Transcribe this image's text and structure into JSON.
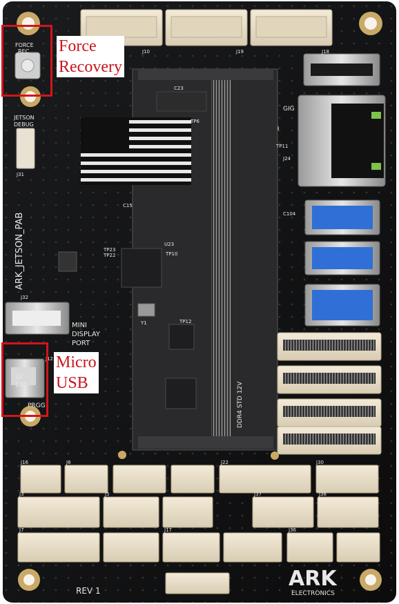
{
  "board": {
    "silkscreen": {
      "board_name": "ARK_JETSON_PAB",
      "force_rec": [
        "FORCE",
        "REC"
      ],
      "jetson_debug": [
        "JETSON",
        "DEBUG"
      ],
      "mini_dp": [
        "MINI",
        "DISPLAY",
        "PORT"
      ],
      "prog": "PRGG",
      "slot": "DDR4 STD 12V",
      "revision": "REV 1",
      "logo": "ARK",
      "brand": "ELECTRONICS",
      "gig": "GIG",
      "refdes": [
        "J10",
        "J19",
        "J18",
        "J22",
        "J30",
        "J16",
        "J6",
        "J3",
        "J5",
        "J37",
        "J38",
        "J7",
        "J17",
        "J36",
        "J32",
        "J12",
        "J24",
        "J31",
        "U23",
        "Y1",
        "TP6",
        "TP10",
        "TP11",
        "TP12",
        "TP22",
        "TP23",
        "C104",
        "C15",
        "C23",
        "22",
        "136"
      ]
    },
    "colors": {
      "pcb": "#0f1011",
      "silk": "#e8e8e8",
      "connector": "#ece1cc",
      "usb_blue": "#2f6fd6",
      "annotation": "#d4141b"
    }
  },
  "annotations": {
    "force_recovery": {
      "lines": [
        "Force",
        "Recovery"
      ]
    },
    "micro_usb": {
      "lines": [
        "Micro",
        "USB"
      ]
    }
  }
}
